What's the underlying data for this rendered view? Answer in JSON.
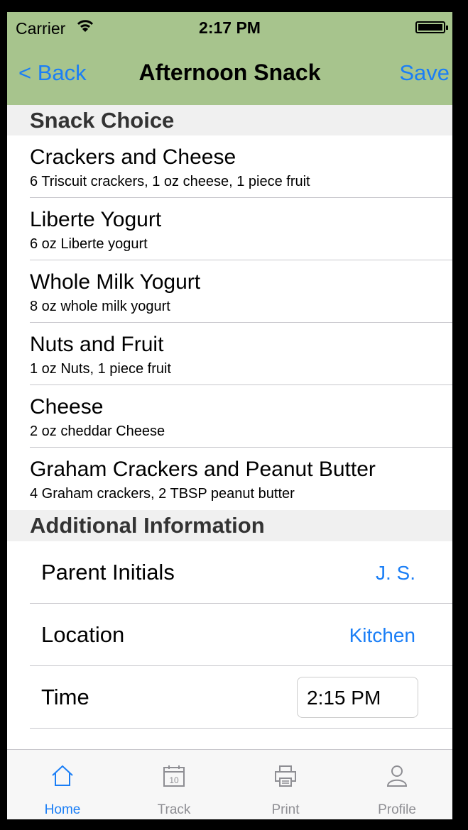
{
  "status_bar": {
    "carrier": "Carrier",
    "time": "2:17 PM"
  },
  "nav": {
    "back_label": "< Back",
    "title": "Afternoon Snack",
    "save_label": "Save"
  },
  "colors": {
    "bar_green": "#a7c48d",
    "accent_blue": "#1a7ef6",
    "tab_inactive": "#8e8e93"
  },
  "snack_section": {
    "header": "Snack Choice",
    "items": [
      {
        "title": "Crackers and Cheese",
        "subtitle": "6 Triscuit crackers, 1 oz cheese, 1 piece fruit"
      },
      {
        "title": "Liberte Yogurt",
        "subtitle": "6 oz Liberte yogurt"
      },
      {
        "title": "Whole Milk Yogurt",
        "subtitle": "8 oz whole milk yogurt"
      },
      {
        "title": "Nuts and Fruit",
        "subtitle": "1 oz Nuts, 1 piece fruit"
      },
      {
        "title": "Cheese",
        "subtitle": "2 oz cheddar Cheese"
      },
      {
        "title": "Graham Crackers and Peanut Butter",
        "subtitle": "4 Graham crackers, 2 TBSP peanut butter"
      }
    ]
  },
  "info_section": {
    "header": "Additional Information",
    "parent_initials": {
      "label": "Parent Initials",
      "value": "J. S."
    },
    "location": {
      "label": "Location",
      "value": "Kitchen"
    },
    "time": {
      "label": "Time",
      "value": "2:15 PM"
    }
  },
  "tabs": [
    {
      "label": "Home",
      "icon": "house-icon",
      "active": true
    },
    {
      "label": "Track",
      "icon": "calendar-icon",
      "active": false,
      "icon_text": "10"
    },
    {
      "label": "Print",
      "icon": "printer-icon",
      "active": false
    },
    {
      "label": "Profile",
      "icon": "person-icon",
      "active": false
    }
  ]
}
